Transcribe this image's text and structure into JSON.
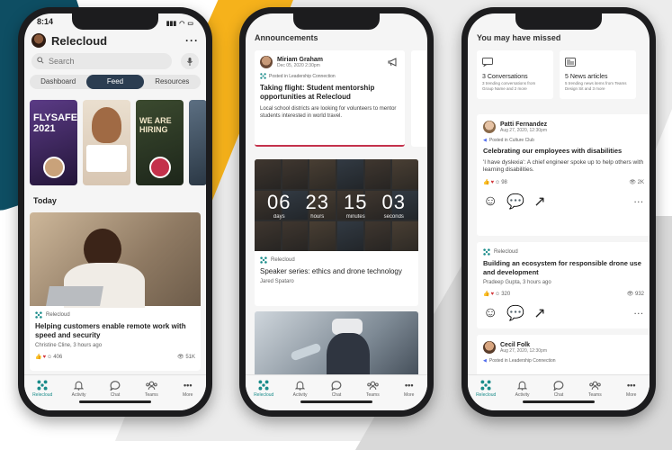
{
  "colors": {
    "accent": "#1a8c8a",
    "tab_active": "#2b3d51",
    "heart": "#d13438",
    "like": "#f6b21b"
  },
  "phone1": {
    "time": "8:14",
    "title": "Relecloud",
    "search_placeholder": "Search",
    "tabs": [
      "Dashboard",
      "Feed",
      "Resources"
    ],
    "active_tab": "Feed",
    "stories": [
      {
        "text": "FLYSAFE 2021",
        "bg": "#3c2a52"
      },
      {
        "text": "",
        "bg": "#e8e0d6"
      },
      {
        "text": "WE ARE HIRING",
        "bg": "#2c3a2c"
      },
      {
        "text": "",
        "bg": "#4a5a6a"
      }
    ],
    "section": "Today",
    "card": {
      "source": "Relecloud",
      "title": "Helping customers enable remote work with speed and security",
      "meta": "Christine Cline, 3 hours ago",
      "reactions": "406",
      "views": "51K"
    },
    "nav": [
      "Relecloud",
      "Activity",
      "Chat",
      "Teams",
      "More"
    ]
  },
  "phone2": {
    "section": "Announcements",
    "announcement": {
      "name": "Miriam Graham",
      "date": "Dec 05, 2020 2:30pm",
      "posted": "Posted in Leadership Connection",
      "title": "Taking flight: Student mentorship opportunities at Relecloud",
      "body": "Local school districts are looking for volunteers to mentor students interested in world travel."
    },
    "countdown": [
      {
        "num": "06",
        "label": "days"
      },
      {
        "num": "23",
        "label": "hours"
      },
      {
        "num": "15",
        "label": "minutes"
      },
      {
        "num": "03",
        "label": "seconds"
      }
    ],
    "event": {
      "source": "Relecloud",
      "title": "Speaker series: ethics and drone technology",
      "author": "Jared Spataro"
    },
    "nav": [
      "Relecloud",
      "Activity",
      "Chat",
      "Teams",
      "More"
    ]
  },
  "phone3": {
    "section": "You may have missed",
    "tiles": [
      {
        "title": "3 Conversations",
        "sub": "3 trending conversations from Group Name and 2 more"
      },
      {
        "title": "5 News articles",
        "sub": "5 trending news items from Teams Design Sit and 3 more"
      }
    ],
    "post1": {
      "name": "Patti Fernandez",
      "date": "Aug 27, 2020, 12:30pm",
      "posted": "Posted in Culture Club",
      "title": "Celebrating our employees with disabilities",
      "body": "'I have dyslexia': A chief engineer spoke up to help others with learning disabilities.",
      "reactions": "98",
      "views": "2K"
    },
    "post2": {
      "source": "Relecloud",
      "title": "Building an ecosystem for responsible drone use and development",
      "author": "Pradeep Gupta, 3 hours ago",
      "reactions": "320",
      "views": "932"
    },
    "post3": {
      "name": "Cecil Folk",
      "date": "Aug 27, 2020, 12:30pm",
      "posted": "Posted in Leadership Connection"
    },
    "nav": [
      "Relecloud",
      "Activity",
      "Chat",
      "Teams",
      "More"
    ]
  }
}
